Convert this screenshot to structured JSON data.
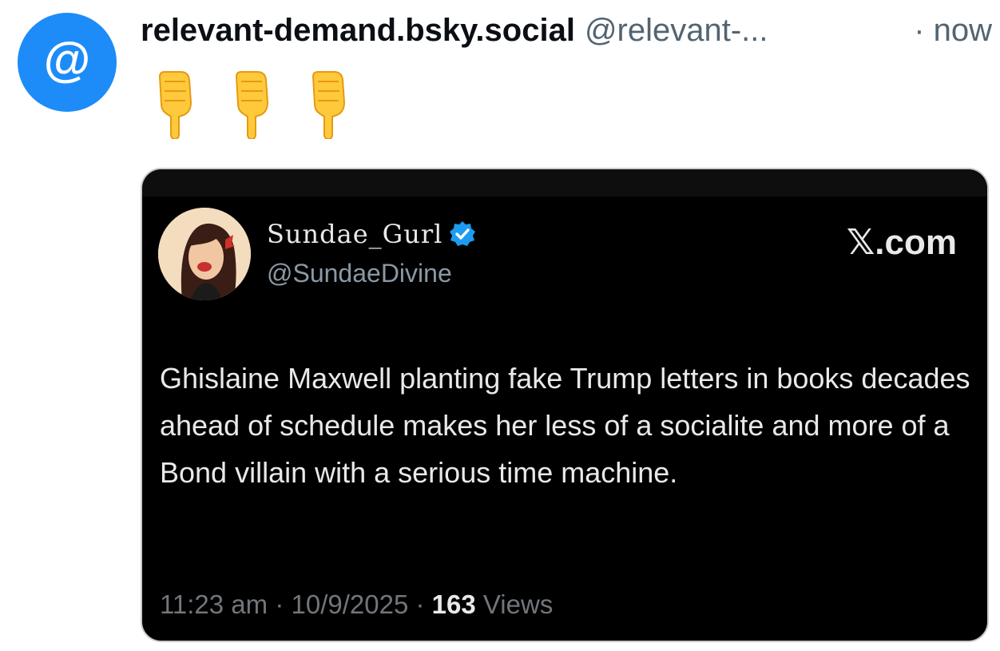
{
  "post": {
    "avatar_icon": "at-sign-icon",
    "display_name": "relevant-demand.bsky.social",
    "handle": "@relevant-...",
    "time": "· now",
    "body_emoji": [
      "👇",
      "👇",
      "👇"
    ]
  },
  "embed": {
    "author_name": "Sundae_Gurl",
    "verified_icon": "verified-badge-icon",
    "author_handle": "@SundaeDivine",
    "source": "𝕏.com",
    "text": "Ghislaine Maxwell planting fake Trump letters in books decades ahead of schedule makes her less of a socialite and more of a Bond villain with a serious time machine.",
    "time": "11:23 am",
    "separator": "·",
    "date": "10/9/2025",
    "views_count": "163",
    "views_label": "Views"
  },
  "colors": {
    "avatar_bg": "#1d8cf8",
    "verified_blue": "#1d9bf0",
    "embed_bg": "#000000",
    "handle_gray": "#536471"
  }
}
